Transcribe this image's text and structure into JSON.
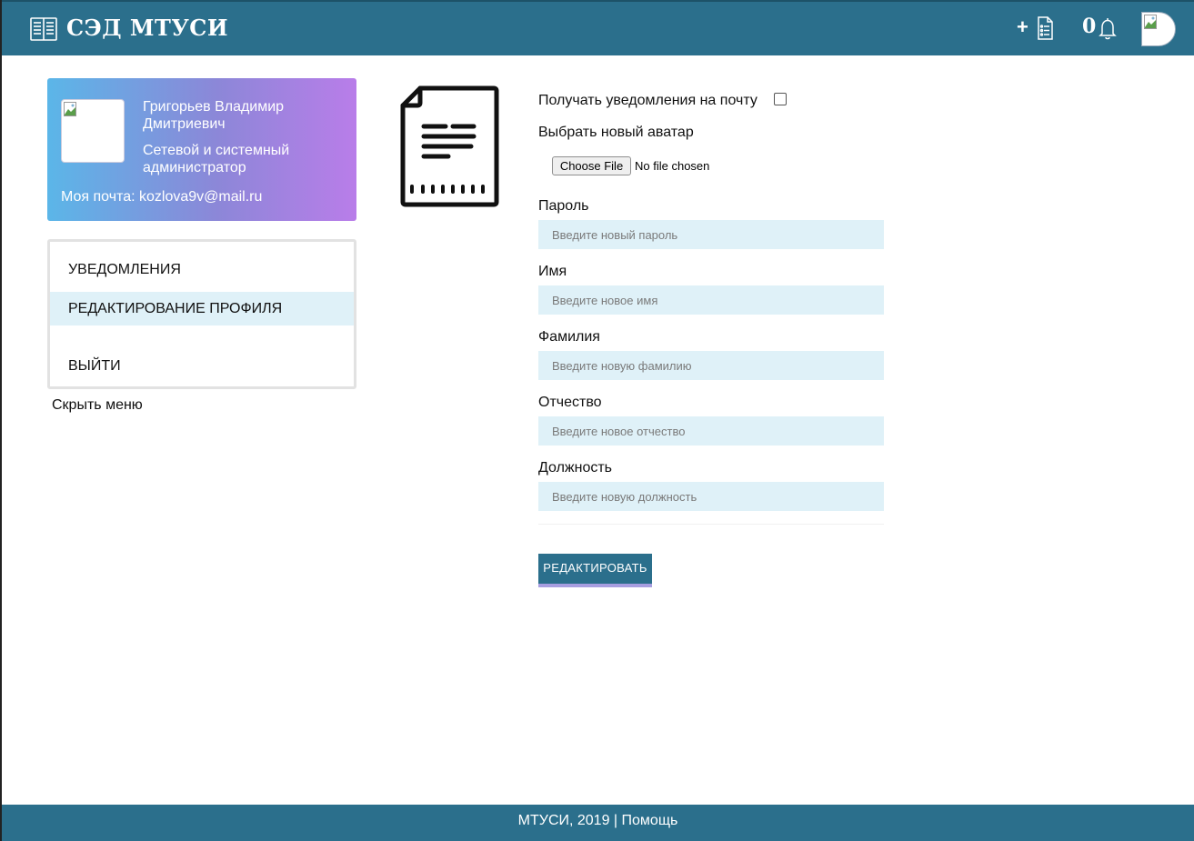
{
  "header": {
    "brand": "СЭД МТУСИ",
    "add_label": "+",
    "notification_count": "0",
    "icons": {
      "logo": "open-book-icon",
      "add_document": "document-list-icon",
      "notifications": "bell-icon",
      "avatar": "user-avatar"
    }
  },
  "profile": {
    "name": "Григорьев Владимир Дмитриевич",
    "role": "Сетевой и системный администратор",
    "email": "Моя почта: kozlova9v@mail.ru"
  },
  "menu": {
    "items": [
      {
        "label": "УВЕДОМЛЕНИЯ"
      },
      {
        "label": "РЕДАКТИРОВАНИЕ ПРОФИЛЯ"
      },
      {
        "label": "ВЫЙТИ"
      }
    ],
    "hide_label": "Скрыть меню"
  },
  "form": {
    "email_notify_label": "Получать уведомления на почту",
    "avatar_label": "Выбрать новый аватар",
    "file_button": "Choose File",
    "file_status": "No file chosen",
    "password_label": "Пароль",
    "password_placeholder": "Введите новый пароль",
    "name_label": "Имя",
    "name_placeholder": "Введите новое имя",
    "surname_label": "Фамилия",
    "surname_placeholder": "Введите новую фамилию",
    "patronymic_label": "Отчество",
    "patronymic_placeholder": "Введите новое отчество",
    "position_label": "Должность",
    "position_placeholder": "Введите новую должность",
    "submit_label": "РЕДАКТИРОВАТЬ"
  },
  "footer": {
    "org": "МТУСИ, 2019",
    "separator": " | ",
    "help": "Помощь"
  },
  "colors": {
    "primary": "#2b6f8c",
    "input_bg": "#dff1f8",
    "card_gradient_start": "#5bb6e8",
    "card_gradient_end": "#b97de9",
    "button_accent": "#a79ee0"
  }
}
